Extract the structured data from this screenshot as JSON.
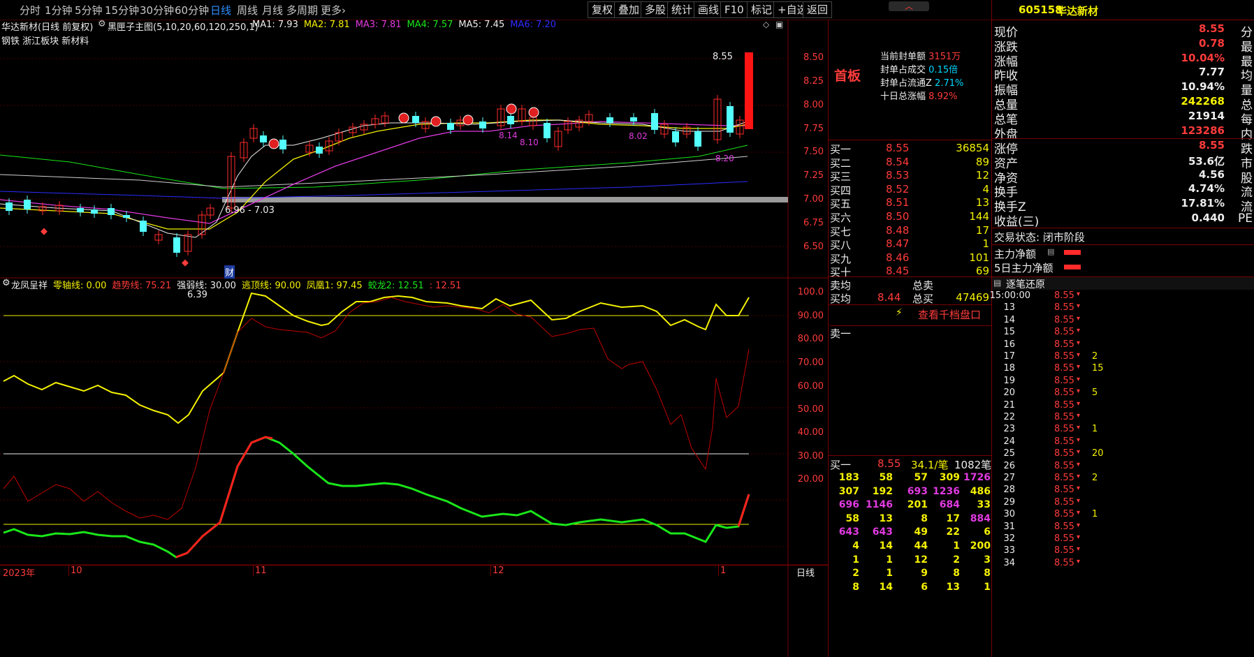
{
  "toolbar": {
    "periods": [
      "分时",
      "1分钟",
      "5分钟",
      "15分钟",
      "30分钟",
      "60分钟",
      "日线",
      "周线",
      "月线",
      "多周期",
      "更多"
    ],
    "buttons": [
      "复权",
      "叠加",
      "多股",
      "统计",
      "画线",
      "F10",
      "标记",
      "+自选",
      "返回"
    ],
    "collapse_icon": "chevron-up-icon"
  },
  "main_chart": {
    "title": "华达新材(日线 前复权)",
    "indicator_name": "黑匣子主图(5,10,20,60,120,250,1)",
    "ma": [
      {
        "label": "MA1: 7.93",
        "color": "#ededed"
      },
      {
        "label": "MA2: 7.81",
        "color": "#f4f100"
      },
      {
        "label": "MA3: 7.81",
        "color": "#e03ae0"
      },
      {
        "label": "MA4: 7.57",
        "color": "#19e619"
      },
      {
        "label": "MA5: 7.45",
        "color": "#ededed"
      },
      {
        "label": "MA6: 7.20",
        "color": "#2c2cff"
      }
    ],
    "sector_tags": "钢铁 浙江板块 新材料",
    "y_ticks": [
      "8.50",
      "8.25",
      "8.00",
      "7.75",
      "7.50",
      "7.25",
      "7.00",
      "6.75",
      "6.50"
    ],
    "annotations": {
      "high_label": "8.55",
      "low_label": "6.39",
      "range_label": "6.96 - 7.03",
      "p814": "8.14",
      "p810": "8.10",
      "p802": "8.02",
      "p820": "8.20",
      "cai": "财"
    }
  },
  "sub_chart": {
    "title": "龙凤呈祥",
    "legend": [
      {
        "label": "零轴线: 0.00",
        "color": "#f4f100"
      },
      {
        "label": "趋势线: 75.21",
        "color": "#ff3b3b"
      },
      {
        "label": "强弱线: 30.00",
        "color": "#ededed"
      },
      {
        "label": "逃顶线: 90.00",
        "color": "#f4f100"
      },
      {
        "label": "凤凰1: 97.45",
        "color": "#f4f100"
      },
      {
        "label": "蛟龙2: 12.51",
        "color": "#19e619"
      },
      {
        "label": ": 12.51",
        "color": "#ff3b3b"
      }
    ],
    "y_ticks": [
      "100.0",
      "90.00",
      "80.00",
      "70.00",
      "60.00",
      "50.00",
      "40.00",
      "30.00",
      "20.00"
    ]
  },
  "x_axis": [
    "2023年",
    "10",
    "11",
    "12",
    "1"
  ],
  "x_axis_right": "日线",
  "middle_panel": {
    "board_label": "首板",
    "seal_info": [
      {
        "label": "当前封单额",
        "value": "3151万",
        "color": "#ff3b3b"
      },
      {
        "label": "封单占成交",
        "value": "0.15倍",
        "color": "#00d8ff"
      },
      {
        "label": "封单占流通Z",
        "value": "2.71%",
        "color": "#00d8ff"
      },
      {
        "label": "十日总涨幅",
        "value": "8.92%",
        "color": "#ff3b3b"
      }
    ],
    "buy_levels": [
      {
        "name": "买一",
        "price": "8.55",
        "vol": "36854"
      },
      {
        "name": "买二",
        "price": "8.54",
        "vol": "89"
      },
      {
        "name": "买三",
        "price": "8.53",
        "vol": "12"
      },
      {
        "name": "买四",
        "price": "8.52",
        "vol": "4"
      },
      {
        "name": "买五",
        "price": "8.51",
        "vol": "13"
      },
      {
        "name": "买六",
        "price": "8.50",
        "vol": "144"
      },
      {
        "name": "买七",
        "price": "8.48",
        "vol": "17"
      },
      {
        "name": "买八",
        "price": "8.47",
        "vol": "1"
      },
      {
        "name": "买九",
        "price": "8.46",
        "vol": "101"
      },
      {
        "name": "买十",
        "price": "8.45",
        "vol": "69"
      }
    ],
    "sell_avg_label": "卖均",
    "total_sell_label": "总卖",
    "buy_avg_label": "买均",
    "buy_avg": "8.44",
    "total_buy_label": "总买",
    "total_buy": "47469",
    "view_depth": "查看千档盘口",
    "sell1_label": "卖一",
    "buy1_summary": {
      "name": "买一",
      "price": "8.55",
      "per": "34.1/笔",
      "count": "1082笔"
    },
    "order_grid": [
      [
        "183",
        "58",
        "57",
        "309",
        "1726"
      ],
      [
        "307",
        "192",
        "693",
        "1236",
        "486"
      ],
      [
        "696",
        "1146",
        "201",
        "684",
        "33"
      ],
      [
        "58",
        "13",
        "8",
        "17",
        "884"
      ],
      [
        "643",
        "643",
        "49",
        "22",
        "6"
      ],
      [
        "4",
        "14",
        "44",
        "1",
        "200"
      ],
      [
        "1",
        "1",
        "12",
        "2",
        "3"
      ],
      [
        "2",
        "1",
        "9",
        "8",
        "8"
      ],
      [
        "8",
        "14",
        "6",
        "13",
        "1"
      ]
    ]
  },
  "right_panel": {
    "code": "605158",
    "name": "华达新材",
    "quote": [
      {
        "label": "现价",
        "value": "8.55",
        "color": "#ff3b3b",
        "tail": "分"
      },
      {
        "label": "涨跌",
        "value": "0.78",
        "color": "#ff3b3b",
        "tail": "最"
      },
      {
        "label": "涨幅",
        "value": "10.04%",
        "color": "#ff3b3b",
        "tail": "最"
      },
      {
        "label": "昨收",
        "value": "7.77",
        "color": "#ededed",
        "tail": "均"
      },
      {
        "label": "振幅",
        "value": "10.94%",
        "color": "#ededed",
        "tail": "量"
      },
      {
        "label": "总量",
        "value": "242268",
        "color": "#f4f100",
        "tail": "总"
      },
      {
        "label": "总笔",
        "value": "21914",
        "color": "#ededed",
        "tail": "每"
      },
      {
        "label": "外盘",
        "value": "123286",
        "color": "#ff3b3b",
        "tail": "内"
      }
    ],
    "quote2": [
      {
        "label": "涨停",
        "value": "8.55",
        "color": "#ff3b3b",
        "tail": "跌"
      },
      {
        "label": "资产",
        "value": "53.6亿",
        "color": "#ededed",
        "tail": "市"
      },
      {
        "label": "净资",
        "value": "4.56",
        "color": "#ededed",
        "tail": "股"
      },
      {
        "label": "换手",
        "value": "4.74%",
        "color": "#ededed",
        "tail": "流"
      },
      {
        "label": "换手Z",
        "value": "17.81%",
        "color": "#ededed",
        "tail": "流"
      },
      {
        "label": "收益(三)",
        "value": "0.440",
        "color": "#ededed",
        "tail": "PE"
      }
    ],
    "trade_status": "交易状态: 闭市阶段",
    "main_net": "主力净额",
    "main_net_5d": "5日主力净额",
    "ticks_title": "逐笔还原",
    "ticks": [
      {
        "t": "15:00:00",
        "p": "8.55",
        "v": ""
      },
      {
        "t": "13",
        "p": "8.55",
        "v": ""
      },
      {
        "t": "14",
        "p": "8.55",
        "v": ""
      },
      {
        "t": "15",
        "p": "8.55",
        "v": ""
      },
      {
        "t": "16",
        "p": "8.55",
        "v": ""
      },
      {
        "t": "17",
        "p": "8.55",
        "v": "2"
      },
      {
        "t": "18",
        "p": "8.55",
        "v": "15"
      },
      {
        "t": "19",
        "p": "8.55",
        "v": ""
      },
      {
        "t": "20",
        "p": "8.55",
        "v": "5"
      },
      {
        "t": "21",
        "p": "8.55",
        "v": ""
      },
      {
        "t": "22",
        "p": "8.55",
        "v": ""
      },
      {
        "t": "23",
        "p": "8.55",
        "v": "1"
      },
      {
        "t": "24",
        "p": "8.55",
        "v": ""
      },
      {
        "t": "25",
        "p": "8.55",
        "v": "20"
      },
      {
        "t": "26",
        "p": "8.55",
        "v": ""
      },
      {
        "t": "27",
        "p": "8.55",
        "v": "2"
      },
      {
        "t": "28",
        "p": "8.55",
        "v": ""
      },
      {
        "t": "29",
        "p": "8.55",
        "v": ""
      },
      {
        "t": "30",
        "p": "8.55",
        "v": "1"
      },
      {
        "t": "31",
        "p": "8.55",
        "v": ""
      },
      {
        "t": "32",
        "p": "8.55",
        "v": ""
      },
      {
        "t": "33",
        "p": "8.55",
        "v": ""
      },
      {
        "t": "34",
        "p": "8.55",
        "v": ""
      }
    ]
  }
}
